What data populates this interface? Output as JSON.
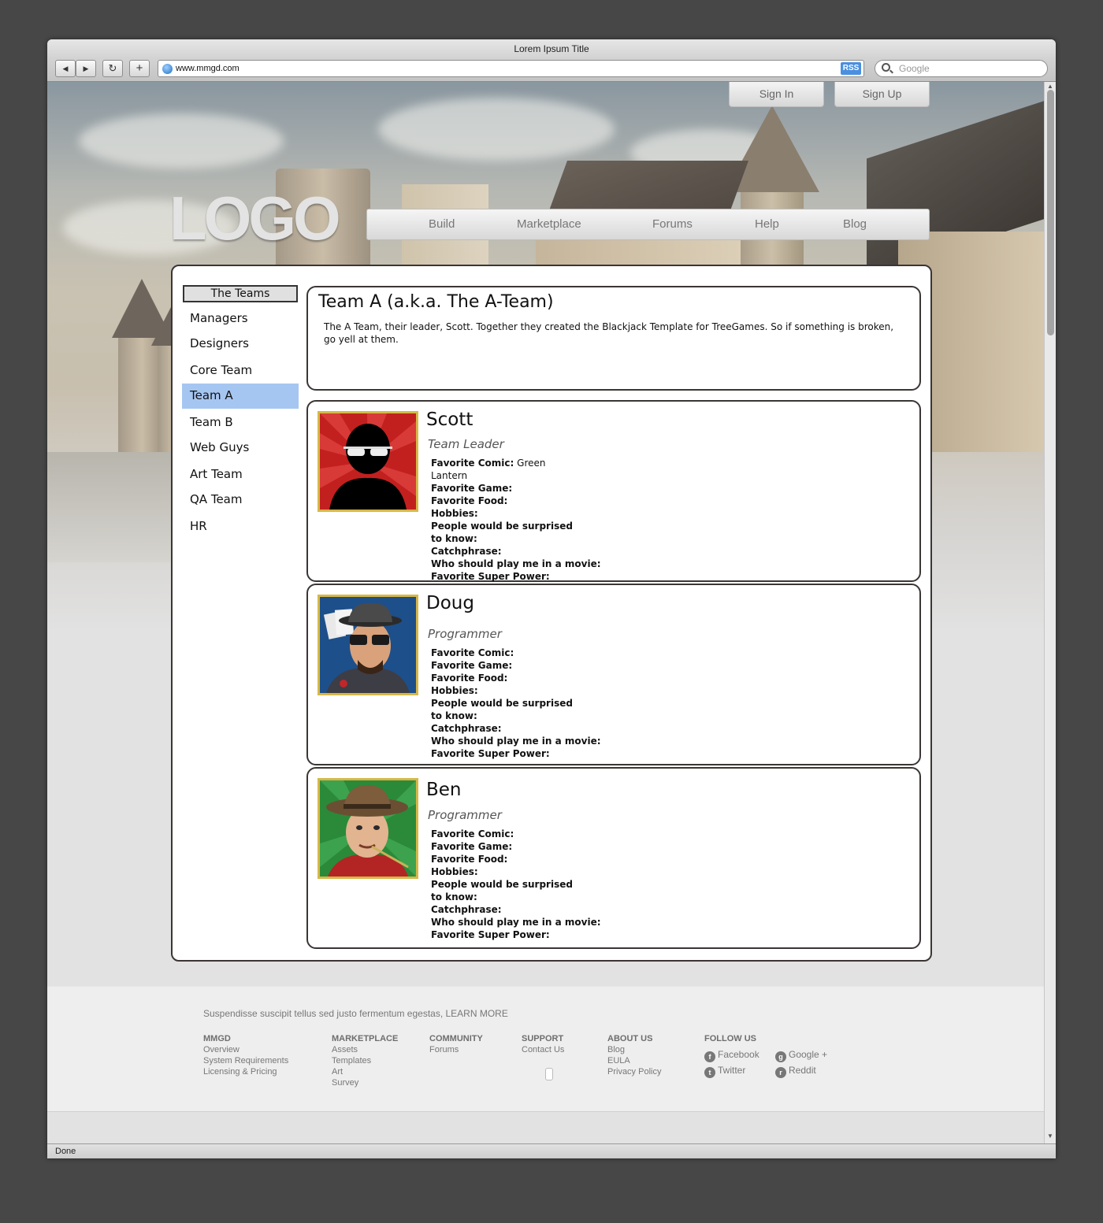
{
  "window": {
    "title": "Lorem Ipsum Title",
    "status": "Done"
  },
  "toolbar": {
    "back": "◀",
    "forward": "▶",
    "reload": "↻",
    "add": "+",
    "url": "www.mmgd.com",
    "rss": "RSS",
    "search_placeholder": "Google"
  },
  "auth": {
    "sign_in": "Sign In",
    "sign_up": "Sign Up"
  },
  "logo": "LOGO",
  "nav": [
    "Build",
    "Marketplace",
    "Forums",
    "Help",
    "Blog"
  ],
  "sidebar": {
    "header": "The Teams",
    "items": [
      "Managers",
      "Designers",
      "Core Team",
      "Team A",
      "Team B",
      "Web Guys",
      "Art Team",
      "QA Team",
      "HR"
    ],
    "active": "Team A"
  },
  "team": {
    "title": "Team A (a.k.a. The A-Team)",
    "description": "The A Team, their leader, Scott. Together they created the Blackjack Template for TreeGames. So if something is broken, go yell at them."
  },
  "field_labels": {
    "comic": "Favorite Comic:",
    "game": "Favorite Game:",
    "food": "Favorite Food:",
    "hobbies": "Hobbies:",
    "surprise": "People would be surprised to know:",
    "catchphrase": "Catchphrase:",
    "movie": "Who should play me in a movie:",
    "power": "Favorite Super Power:"
  },
  "members": [
    {
      "name": "Scott",
      "role": "Team Leader",
      "comic": "Green Lantern",
      "avatar": "silhouette-avatar"
    },
    {
      "name": "Doug",
      "role": "Programmer",
      "comic": "",
      "avatar": "gangster-avatar"
    },
    {
      "name": "Ben",
      "role": "Programmer",
      "comic": "",
      "avatar": "cowboy-avatar"
    }
  ],
  "footer": {
    "tagline": "Suspendisse suscipit tellus sed justo fermentum egestas,",
    "learn_more": "LEARN MORE",
    "columns": [
      {
        "heading": "MMGD",
        "links": [
          "Overview",
          "System Requirements",
          "Licensing & Pricing"
        ]
      },
      {
        "heading": "MARKETPLACE",
        "links": [
          "Assets",
          "Templates",
          "Art",
          "Survey"
        ]
      },
      {
        "heading": "COMMUNITY",
        "links": [
          "Forums"
        ]
      },
      {
        "heading": "SUPPORT",
        "links": [
          "Contact Us"
        ]
      },
      {
        "heading": "ABOUT US",
        "links": [
          "Blog",
          "EULA",
          "Privacy Policy"
        ]
      }
    ],
    "follow": {
      "heading": "FOLLOW US",
      "facebook": "Facebook",
      "google": "Google +",
      "twitter": "Twitter",
      "reddit": "Reddit"
    }
  },
  "colors": {
    "active_nav": "#a6c6f2",
    "avatar_frame": "#d6b848",
    "background": "#474747"
  }
}
